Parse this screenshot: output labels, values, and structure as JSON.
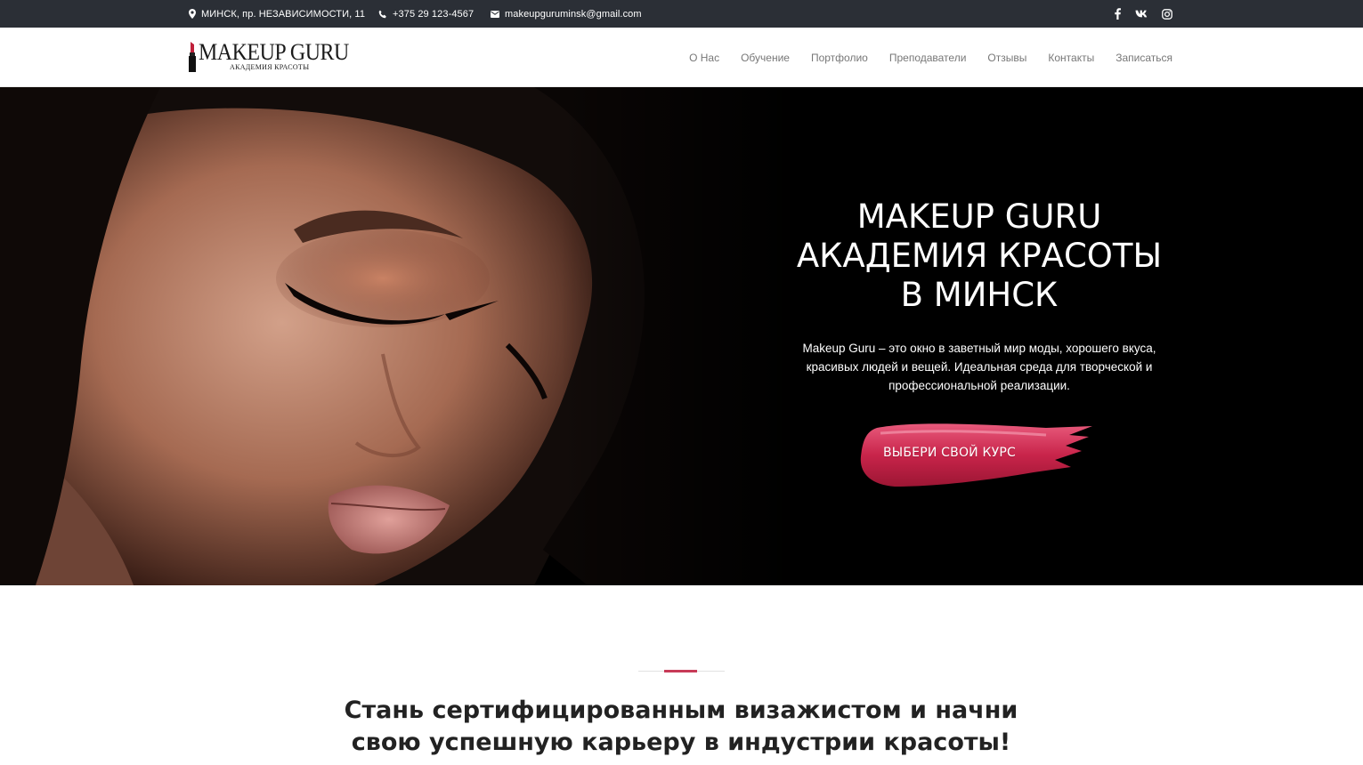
{
  "topbar": {
    "address": "МИНСК, пр. НЕЗАВИСИМОСТИ, 11",
    "phone": "+375 29 123-4567",
    "email": "makeupguruminsk@gmail.com",
    "social": [
      "facebook-icon",
      "vk-icon",
      "instagram-icon"
    ]
  },
  "header": {
    "logo_title": "MAKEUP GURU",
    "logo_subtitle": "АКАДЕМИЯ КРАСОТЫ",
    "nav": [
      "О Нас",
      "Обучение",
      "Портфолио",
      "Преподаватели",
      "Отзывы",
      "Контакты",
      "Записаться"
    ]
  },
  "hero": {
    "title_lines": [
      "MAKEUP GURU",
      "АКАДЕМИЯ КРАСОТЫ",
      "В МИНСК"
    ],
    "description": "Makeup Guru – это окно в заветный мир моды, хорошего вкуса, красивых людей и вещей. Идеальная среда для творческой и профессиональной реализации.",
    "cta_label": "ВЫБЕРИ СВОЙ КУРС"
  },
  "intro": {
    "title_lines": [
      "Стань сертифицированным визажистом и начни",
      "свою успешную карьеру в индустрии красоты!"
    ]
  },
  "colors": {
    "topbar_bg": "#2b2f36",
    "accent": "#c73a57",
    "hero_bg": "#000000"
  }
}
